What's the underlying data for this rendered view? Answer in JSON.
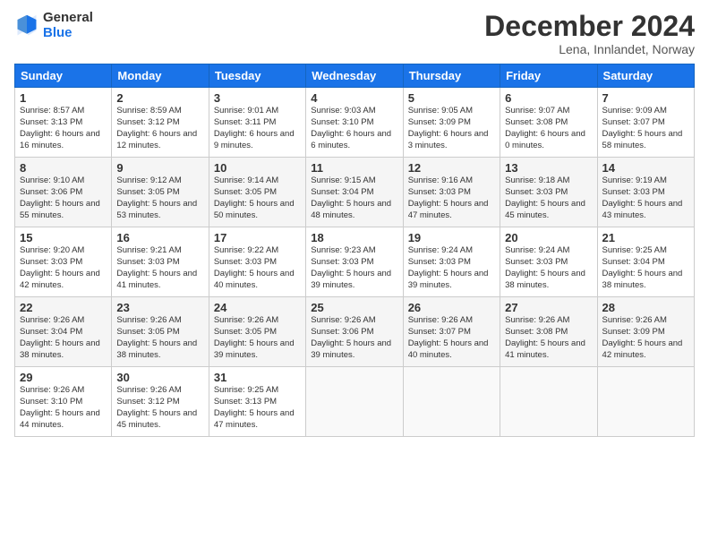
{
  "logo": {
    "general": "General",
    "blue": "Blue"
  },
  "title": "December 2024",
  "location": "Lena, Innlandet, Norway",
  "days": [
    "Sunday",
    "Monday",
    "Tuesday",
    "Wednesday",
    "Thursday",
    "Friday",
    "Saturday"
  ],
  "weeks": [
    [
      {
        "day": "1",
        "sunrise": "8:57 AM",
        "sunset": "3:13 PM",
        "daylight": "6 hours and 16 minutes."
      },
      {
        "day": "2",
        "sunrise": "8:59 AM",
        "sunset": "3:12 PM",
        "daylight": "6 hours and 12 minutes."
      },
      {
        "day": "3",
        "sunrise": "9:01 AM",
        "sunset": "3:11 PM",
        "daylight": "6 hours and 9 minutes."
      },
      {
        "day": "4",
        "sunrise": "9:03 AM",
        "sunset": "3:10 PM",
        "daylight": "6 hours and 6 minutes."
      },
      {
        "day": "5",
        "sunrise": "9:05 AM",
        "sunset": "3:09 PM",
        "daylight": "6 hours and 3 minutes."
      },
      {
        "day": "6",
        "sunrise": "9:07 AM",
        "sunset": "3:08 PM",
        "daylight": "6 hours and 0 minutes."
      },
      {
        "day": "7",
        "sunrise": "9:09 AM",
        "sunset": "3:07 PM",
        "daylight": "5 hours and 58 minutes."
      }
    ],
    [
      {
        "day": "8",
        "sunrise": "9:10 AM",
        "sunset": "3:06 PM",
        "daylight": "5 hours and 55 minutes."
      },
      {
        "day": "9",
        "sunrise": "9:12 AM",
        "sunset": "3:05 PM",
        "daylight": "5 hours and 53 minutes."
      },
      {
        "day": "10",
        "sunrise": "9:14 AM",
        "sunset": "3:05 PM",
        "daylight": "5 hours and 50 minutes."
      },
      {
        "day": "11",
        "sunrise": "9:15 AM",
        "sunset": "3:04 PM",
        "daylight": "5 hours and 48 minutes."
      },
      {
        "day": "12",
        "sunrise": "9:16 AM",
        "sunset": "3:03 PM",
        "daylight": "5 hours and 47 minutes."
      },
      {
        "day": "13",
        "sunrise": "9:18 AM",
        "sunset": "3:03 PM",
        "daylight": "5 hours and 45 minutes."
      },
      {
        "day": "14",
        "sunrise": "9:19 AM",
        "sunset": "3:03 PM",
        "daylight": "5 hours and 43 minutes."
      }
    ],
    [
      {
        "day": "15",
        "sunrise": "9:20 AM",
        "sunset": "3:03 PM",
        "daylight": "5 hours and 42 minutes."
      },
      {
        "day": "16",
        "sunrise": "9:21 AM",
        "sunset": "3:03 PM",
        "daylight": "5 hours and 41 minutes."
      },
      {
        "day": "17",
        "sunrise": "9:22 AM",
        "sunset": "3:03 PM",
        "daylight": "5 hours and 40 minutes."
      },
      {
        "day": "18",
        "sunrise": "9:23 AM",
        "sunset": "3:03 PM",
        "daylight": "5 hours and 39 minutes."
      },
      {
        "day": "19",
        "sunrise": "9:24 AM",
        "sunset": "3:03 PM",
        "daylight": "5 hours and 39 minutes."
      },
      {
        "day": "20",
        "sunrise": "9:24 AM",
        "sunset": "3:03 PM",
        "daylight": "5 hours and 38 minutes."
      },
      {
        "day": "21",
        "sunrise": "9:25 AM",
        "sunset": "3:04 PM",
        "daylight": "5 hours and 38 minutes."
      }
    ],
    [
      {
        "day": "22",
        "sunrise": "9:26 AM",
        "sunset": "3:04 PM",
        "daylight": "5 hours and 38 minutes."
      },
      {
        "day": "23",
        "sunrise": "9:26 AM",
        "sunset": "3:05 PM",
        "daylight": "5 hours and 38 minutes."
      },
      {
        "day": "24",
        "sunrise": "9:26 AM",
        "sunset": "3:05 PM",
        "daylight": "5 hours and 39 minutes."
      },
      {
        "day": "25",
        "sunrise": "9:26 AM",
        "sunset": "3:06 PM",
        "daylight": "5 hours and 39 minutes."
      },
      {
        "day": "26",
        "sunrise": "9:26 AM",
        "sunset": "3:07 PM",
        "daylight": "5 hours and 40 minutes."
      },
      {
        "day": "27",
        "sunrise": "9:26 AM",
        "sunset": "3:08 PM",
        "daylight": "5 hours and 41 minutes."
      },
      {
        "day": "28",
        "sunrise": "9:26 AM",
        "sunset": "3:09 PM",
        "daylight": "5 hours and 42 minutes."
      }
    ],
    [
      {
        "day": "29",
        "sunrise": "9:26 AM",
        "sunset": "3:10 PM",
        "daylight": "5 hours and 44 minutes."
      },
      {
        "day": "30",
        "sunrise": "9:26 AM",
        "sunset": "3:12 PM",
        "daylight": "5 hours and 45 minutes."
      },
      {
        "day": "31",
        "sunrise": "9:25 AM",
        "sunset": "3:13 PM",
        "daylight": "5 hours and 47 minutes."
      },
      null,
      null,
      null,
      null
    ]
  ]
}
